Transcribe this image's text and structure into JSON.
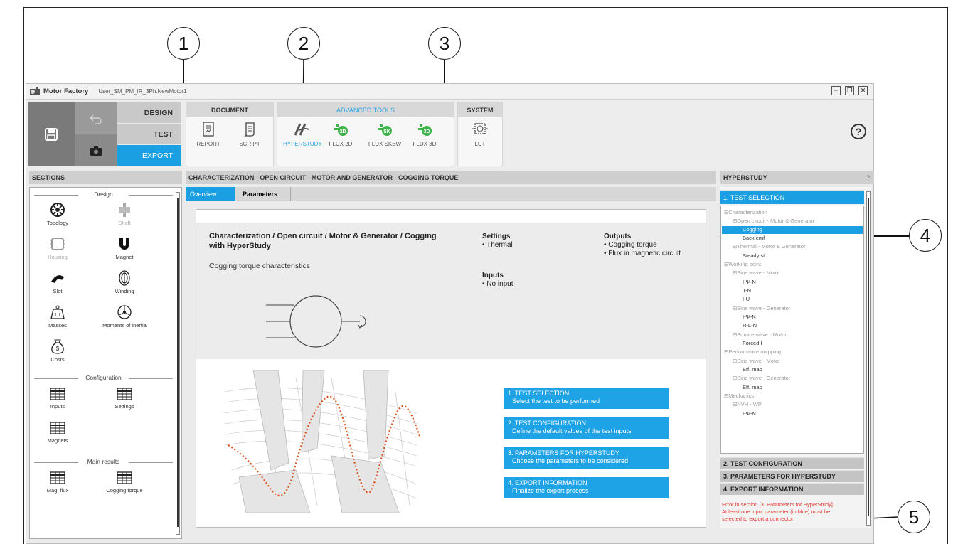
{
  "callouts": [
    "1",
    "2",
    "3",
    "4",
    "5"
  ],
  "titlebar": {
    "app_name": "Motor Factory",
    "file_name": "User_SM_PM_IR_3Ph.NewMotor1",
    "minimize": "−",
    "restore": "❐",
    "close": "✕"
  },
  "modes": {
    "design": "DESIGN",
    "test": "TEST",
    "export": "EXPORT"
  },
  "toolbar": {
    "document": {
      "title": "DOCUMENT",
      "report": "REPORT",
      "script": "SCRIPT"
    },
    "advanced": {
      "title": "ADVANCED TOOLS",
      "hyperstudy": "HYPERSTUDY",
      "flux2d": "FLUX 2D",
      "fluxskew": "FLUX SKEW",
      "flux3d": "FLUX 3D"
    },
    "system": {
      "title": "SYSTEM",
      "lut": "LUT"
    },
    "help": "?",
    "accent": "#1a9fe2"
  },
  "sections": {
    "title": "SECTIONS",
    "design_title": "Design",
    "design_items": [
      "Topology",
      "Shaft",
      "Housing",
      "Magnet",
      "Slot",
      "Winding",
      "Masses",
      "Moments of inertia",
      "Costs"
    ],
    "configuration_title": "Configuration",
    "configuration_items": [
      "Inputs",
      "Settings",
      "Magnets"
    ],
    "results_title": "Main results",
    "results_items": [
      "Mag. flux",
      "Cogging torque"
    ]
  },
  "center": {
    "title": "CHARACTERIZATION - OPEN CIRCUIT - MOTOR AND GENERATOR - COGGING TORQUE",
    "tabs": [
      "Overview",
      "Parameters"
    ],
    "heading_line1": "Characterization / Open circuit / Motor & Generator / Cogging",
    "heading_line2": "with HyperStudy",
    "subtitle": "Cogging torque characteristics",
    "settings_title": "Settings",
    "settings_items": [
      "• Thermal"
    ],
    "inputs_title": "Inputs",
    "inputs_items": [
      "• No input"
    ],
    "outputs_title": "Outputs",
    "outputs_items": [
      "• Cogging torque",
      "• Flux in magnetic circuit"
    ],
    "steps": [
      {
        "title": "1. TEST SELECTION",
        "desc": "Select the test to be performed"
      },
      {
        "title": "2. TEST CONFIGURATION",
        "desc": "Define the default values of the test inputs"
      },
      {
        "title": "3. PARAMETERS FOR HYPERSTUDY",
        "desc": "Choose the parameters to be considered"
      },
      {
        "title": "4. EXPORT INFORMATION",
        "desc": "Finalize the export process"
      }
    ]
  },
  "hyperstudy": {
    "title": "HYPERSTUDY",
    "help": "?",
    "sections": [
      "1. TEST SELECTION",
      "2. TEST CONFIGURATION",
      "3. PARAMETERS FOR HYPERSTUDY",
      "4. EXPORT INFORMATION"
    ],
    "tree": [
      "⊟Characterization",
      "⊟Open circuit - Motor & Generator",
      "Cogging",
      "Back emf",
      "⊟Thermal - Motor & Generator",
      "Steady st.",
      "⊟Working point",
      "⊟Sine wave - Motor",
      "I-Ψ-N",
      "T-N",
      "I-U",
      "⊟Sine wave - Generator",
      "I-Ψ-N",
      "R-L-N",
      "⊟Square wave - Motor",
      "Forced I",
      "⊟Performance mapping",
      "⊟Sine wave - Motor",
      "Eff. map",
      "⊟Sine wave - Generator",
      "Eff. map",
      "⊟Mechanics",
      "⊟NVH - WP",
      "I-Ψ-N"
    ],
    "error_lines": [
      "Error in section [3. Parameters for HyperStudy]",
      "At least one input parameter (in blue) must be",
      "selected to export a connector"
    ],
    "error_color": "#e53935"
  }
}
